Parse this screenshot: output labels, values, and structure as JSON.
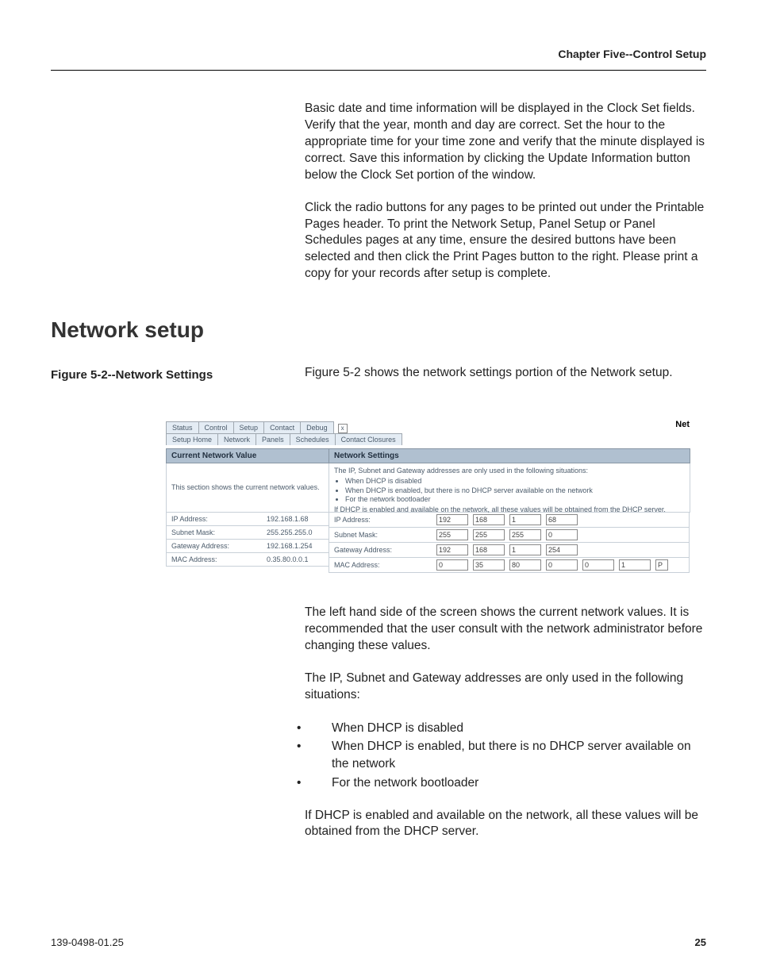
{
  "header": {
    "chapter": "Chapter Five--Control Setup"
  },
  "body": {
    "para1": "Basic date and time information will be displayed in the Clock Set fields. Verify that the year, month and day are correct.  Set the hour to the appropriate time for your time zone and verify that the minute displayed is correct. Save this information by clicking the Update Information button below the Clock Set portion of the window.",
    "para2": "Click the radio buttons for any pages to be printed out under the Printable Pages header. To print the Network Setup, Panel Setup or Panel Schedules pages at any time, ensure the desired buttons have been selected and then click the Print Pages button to the right. Please print a copy for your records after setup is complete.",
    "section_title": "Network setup",
    "figure_caption": "Figure 5-2--Network Settings",
    "figure_intro": "Figure 5-2 shows the network settings portion of the Network setup.",
    "para3": "The left hand side of the screen shows the current network values.   It is recommended that the user consult with the network administrator before changing these values.",
    "para4": "The IP,  Subnet and Gateway addresses are only used in the following situations:",
    "bullets": {
      "b1": "When DHCP is disabled",
      "b2": "When DHCP is enabled, but there is no DHCP server available on the network",
      "b3": "For the network bootloader"
    },
    "para5": "If DHCP is enabled and available on the network, all these values will be obtained from the DHCP server."
  },
  "screenshot": {
    "corner_label": "Net",
    "close": "x",
    "maintabs": {
      "t1": "Status",
      "t2": "Control",
      "t3": "Setup",
      "t4": "Contact",
      "t5": "Debug"
    },
    "subtabs": {
      "s1": "Setup Home",
      "s2": "Network",
      "s3": "Panels",
      "s4": "Schedules",
      "s5": "Contact Closures"
    },
    "left": {
      "header": "Current Network Value",
      "desc": "This section shows the current network values.",
      "rows": {
        "ip": {
          "label": "IP Address:",
          "value": "192.168.1.68"
        },
        "mask": {
          "label": "Subnet Mask:",
          "value": "255.255.255.0"
        },
        "gw": {
          "label": "Gateway Address:",
          "value": "192.168.1.254"
        },
        "mac": {
          "label": "MAC Address:",
          "value": "0.35.80.0.0.1"
        }
      }
    },
    "right": {
      "header": "Network Settings",
      "desc_intro": "The IP, Subnet and Gateway addresses are only used in the following situations:",
      "desc_b1": "When DHCP is disabled",
      "desc_b2": "When DHCP is enabled, but there is no DHCP server available on the network",
      "desc_b3": "For the network bootloader",
      "desc_outro": "If DHCP is enabled and available on the network, all these values will be obtained from the DHCP server.",
      "rows": {
        "ip": {
          "label": "IP Address:",
          "o1": "192",
          "o2": "168",
          "o3": "1",
          "o4": "68"
        },
        "mask": {
          "label": "Subnet Mask:",
          "o1": "255",
          "o2": "255",
          "o3": "255",
          "o4": "0"
        },
        "gw": {
          "label": "Gateway Address:",
          "o1": "192",
          "o2": "168",
          "o3": "1",
          "o4": "254"
        },
        "mac": {
          "label": "MAC Address:",
          "o1": "0",
          "o2": "35",
          "o3": "80",
          "o4": "0",
          "o5": "0",
          "o6": "1",
          "o7": "P"
        }
      }
    }
  },
  "footer": {
    "docnum": "139-0498-01.25",
    "pagenum": "25"
  }
}
